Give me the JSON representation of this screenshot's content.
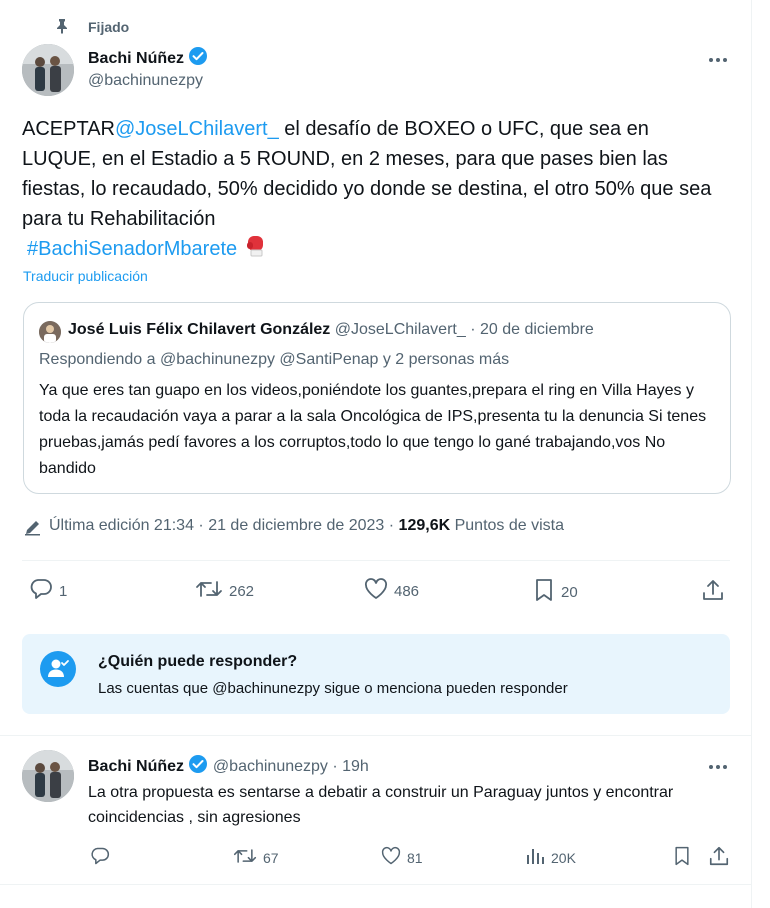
{
  "pinned": {
    "label": "Fijado"
  },
  "tweet": {
    "author_name": "Bachi Núñez",
    "author_handle": "@bachinunezpy",
    "text_start": "ACEPTAR",
    "text_mention": "@JoseLChilavert_",
    "text_body": "  el desafío de BOXEO o UFC, que sea en LUQUE, en el Estadio a 5 ROUND, en 2 meses, para que pases bien las fiestas, lo recaudado, 50% decidido yo donde se destina, el otro 50% que sea para tu Rehabilitación",
    "hashtag": "#BachiSenadorMbarete",
    "translate": "Traducir publicación",
    "edited_label": "Última edición 21:34 · 21 de diciembre de 2023 ·",
    "views_count": "129,6K",
    "views_label": "Puntos de vista",
    "replies": "1",
    "retweets": "262",
    "likes": "486",
    "bookmarks": "20"
  },
  "quote": {
    "author_name": "José Luis Félix Chilavert González",
    "author_handle": "@JoseLChilavert_",
    "date": "· 20 de diciembre",
    "replying_prefix": "Respondiendo a",
    "replying_handles": "@bachinunezpy  @SantiPenap",
    "replying_suffix": " y 2 personas más",
    "text": "Ya que eres tan guapo en los videos,poniéndote los guantes,prepara el ring en Villa Hayes y toda la recaudación vaya a parar a la sala Oncológica de IPS,presenta tu la denuncia Si tenes pruebas,jamás pedí favores a los corruptos,todo lo que tengo lo gané trabajando,vos No bandido"
  },
  "who_can_reply": {
    "title": "¿Quién puede responder?",
    "text": "Las cuentas que @bachinunezpy sigue o menciona pueden responder"
  },
  "reply": {
    "author_name": "Bachi Núñez",
    "author_handle": "@bachinunezpy",
    "time": "· 19h",
    "text": "La otra propuesta es sentarse a debatir a construir un Paraguay juntos y encontrar coincidencias , sin agresiones",
    "retweets": "67",
    "likes": "81",
    "views": "20K"
  },
  "icons": {
    "pin": "pin-icon",
    "verified": "verified-badge-icon",
    "more": "more-icon",
    "boxing_glove": "boxing-glove-emoji",
    "pencil": "pencil-icon",
    "reply": "reply-icon",
    "retweet": "retweet-icon",
    "like": "heart-icon",
    "bookmark": "bookmark-icon",
    "share": "share-icon",
    "views": "views-icon",
    "person_check": "person-check-icon"
  },
  "colors": {
    "accent": "#1d9bf0",
    "text": "#0f1419",
    "muted": "#536471",
    "info_box_bg": "#e8f5fd"
  }
}
